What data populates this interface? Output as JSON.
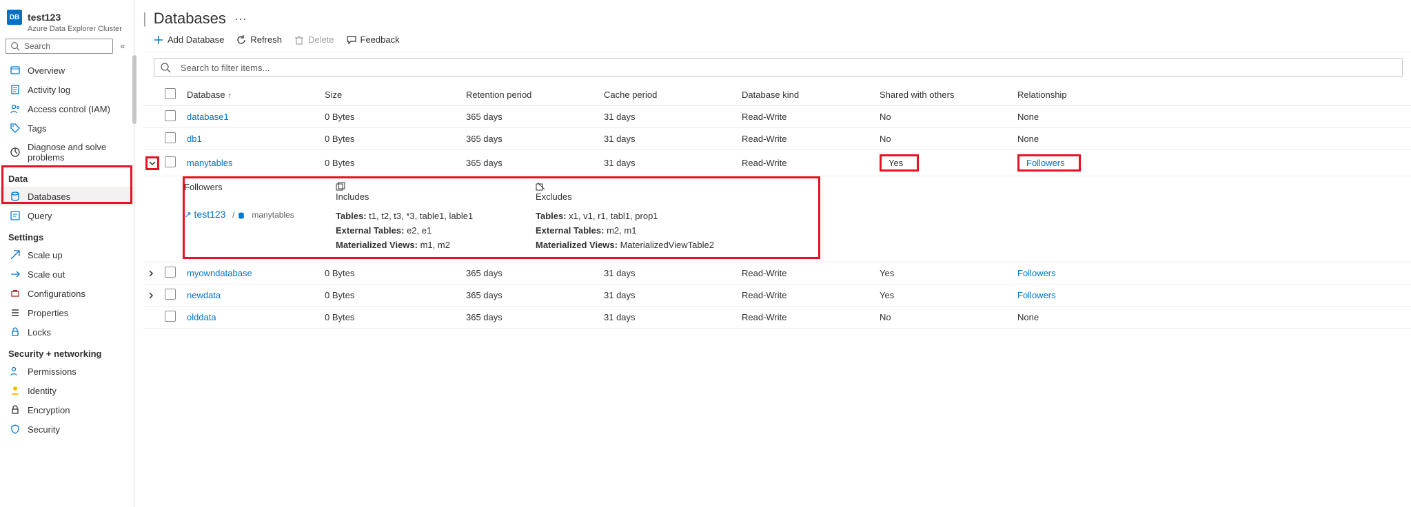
{
  "cluster": {
    "name": "test123",
    "subtitle": "Azure Data Explorer Cluster"
  },
  "sidebar": {
    "search_placeholder": "Search",
    "collapse": "«",
    "top_items": [
      {
        "icon": "overview",
        "label": "Overview"
      },
      {
        "icon": "activity",
        "label": "Activity log"
      },
      {
        "icon": "iam",
        "label": "Access control (IAM)"
      },
      {
        "icon": "tags",
        "label": "Tags"
      },
      {
        "icon": "diagnose",
        "label": "Diagnose and solve problems"
      }
    ],
    "groups": [
      {
        "title": "Data",
        "items": [
          {
            "icon": "database",
            "label": "Databases",
            "selected": true
          },
          {
            "icon": "query",
            "label": "Query"
          }
        ]
      },
      {
        "title": "Settings",
        "items": [
          {
            "icon": "scaleup",
            "label": "Scale up"
          },
          {
            "icon": "scaleout",
            "label": "Scale out"
          },
          {
            "icon": "config",
            "label": "Configurations"
          },
          {
            "icon": "props",
            "label": "Properties"
          },
          {
            "icon": "locks",
            "label": "Locks"
          }
        ]
      },
      {
        "title": "Security + networking",
        "items": [
          {
            "icon": "perm",
            "label": "Permissions"
          },
          {
            "icon": "identity",
            "label": "Identity"
          },
          {
            "icon": "encryption",
            "label": "Encryption"
          },
          {
            "icon": "security",
            "label": "Security"
          }
        ]
      }
    ]
  },
  "page": {
    "title": "Databases"
  },
  "toolbar": {
    "add": "Add Database",
    "refresh": "Refresh",
    "delete": "Delete",
    "feedback": "Feedback"
  },
  "filter": {
    "placeholder": "Search to filter items..."
  },
  "columns": {
    "database": "Database",
    "size": "Size",
    "retention": "Retention period",
    "cache": "Cache period",
    "kind": "Database kind",
    "shared": "Shared with others",
    "relationship": "Relationship"
  },
  "rows": [
    {
      "name": "database1",
      "size": "0 Bytes",
      "retention": "365 days",
      "cache": "31 days",
      "kind": "Read-Write",
      "shared": "No",
      "rel": "None",
      "rel_link": false,
      "expander": false
    },
    {
      "name": "db1",
      "size": "0 Bytes",
      "retention": "365 days",
      "cache": "31 days",
      "kind": "Read-Write",
      "shared": "No",
      "rel": "None",
      "rel_link": false,
      "expander": false
    },
    {
      "name": "manytables",
      "size": "0 Bytes",
      "retention": "365 days",
      "cache": "31 days",
      "kind": "Read-Write",
      "shared": "Yes",
      "rel": "Followers",
      "rel_link": true,
      "expander": "down",
      "highlight": true
    },
    {
      "name": "myowndatabase",
      "size": "0 Bytes",
      "retention": "365 days",
      "cache": "31 days",
      "kind": "Read-Write",
      "shared": "Yes",
      "rel": "Followers",
      "rel_link": true,
      "expander": "right"
    },
    {
      "name": "newdata",
      "size": "0 Bytes",
      "retention": "365 days",
      "cache": "31 days",
      "kind": "Read-Write",
      "shared": "Yes",
      "rel": "Followers",
      "rel_link": true,
      "expander": "right"
    },
    {
      "name": "olddata",
      "size": "0 Bytes",
      "retention": "365 days",
      "cache": "31 days",
      "kind": "Read-Write",
      "shared": "No",
      "rel": "None",
      "rel_link": false,
      "expander": false
    }
  ],
  "detail": {
    "followers_label": "Followers",
    "includes_label": "Includes",
    "excludes_label": "Excludes",
    "cluster_link": "test123",
    "path": "manytables",
    "includes": {
      "Tables": "t1, t2, t3, *3, table1, lable1",
      "External Tables": "e2, e1",
      "Materialized Views": "m1, m2"
    },
    "excludes": {
      "Tables": "x1, v1, r1, tabl1, prop1",
      "External Tables": "m2, m1",
      "Materialized Views": "MaterializedViewTable2"
    }
  }
}
